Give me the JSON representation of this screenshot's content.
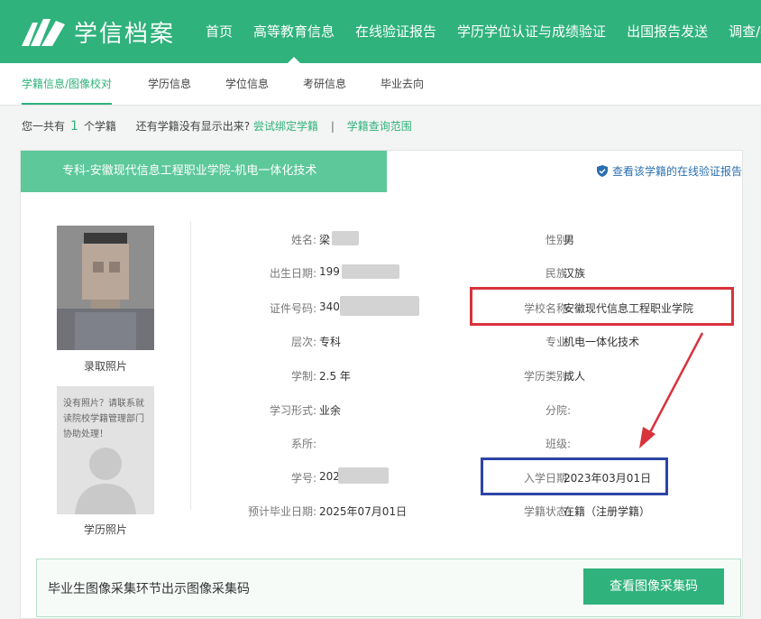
{
  "header": {
    "logo_text": "学信档案",
    "nav": [
      "首页",
      "高等教育信息",
      "在线验证报告",
      "学历学位认证与成绩验证",
      "出国报告发送",
      "调查/投票"
    ]
  },
  "subnav": [
    "学籍信息/图像校对",
    "学历信息",
    "学位信息",
    "考研信息",
    "毕业去向"
  ],
  "count_line": {
    "prefix": "您一共有",
    "count": "1",
    "suffix": "个学籍",
    "question": "还有学籍没有显示出来?",
    "bind_link": "尝试绑定学籍",
    "separator": "|",
    "range_link": "学籍查询范围"
  },
  "record": {
    "title": "专科-安徽现代信息工程职业学院-机电一体化技术",
    "verify_link": "查看该学籍的在线验证报告",
    "photo_label": "录取照片",
    "placeholder_text": "没有照片？请联系就读院校学籍管理部门协助处理！",
    "edu_photo_label": "学历照片",
    "left_fields": [
      {
        "label": "姓名:",
        "value": "梁"
      },
      {
        "label": "出生日期:",
        "value": "199"
      },
      {
        "label": "证件号码:",
        "value": "340"
      },
      {
        "label": "层次:",
        "value": "专科"
      },
      {
        "label": "学制:",
        "value": "2.5 年"
      },
      {
        "label": "学习形式:",
        "value": "业余"
      },
      {
        "label": "系所:",
        "value": ""
      },
      {
        "label": "学号:",
        "value": "202"
      },
      {
        "label": "预计毕业日期:",
        "value": "2025年07月01日"
      }
    ],
    "right_fields": [
      {
        "label": "性别:",
        "value": "男"
      },
      {
        "label": "民族:",
        "value": "汉族"
      },
      {
        "label": "学校名称:",
        "value": "安徽现代信息工程职业学院"
      },
      {
        "label": "专业:",
        "value": "机电一体化技术"
      },
      {
        "label": "学历类别:",
        "value": "成人"
      },
      {
        "label": "分院:",
        "value": ""
      },
      {
        "label": "班级:",
        "value": ""
      },
      {
        "label": "入学日期:",
        "value": "2023年03月01日"
      },
      {
        "label": "学籍状态:",
        "value": "在籍（注册学籍）"
      }
    ]
  },
  "bottom": {
    "text": "毕业生图像采集环节出示图像采集码",
    "button": "查看图像采集码"
  },
  "colors": {
    "brand_green": "#2fb27c",
    "title_green": "#5dc89a",
    "highlight_red": "#d8323b",
    "highlight_blue": "#2b44a4",
    "link_blue": "#2a6fb0"
  }
}
